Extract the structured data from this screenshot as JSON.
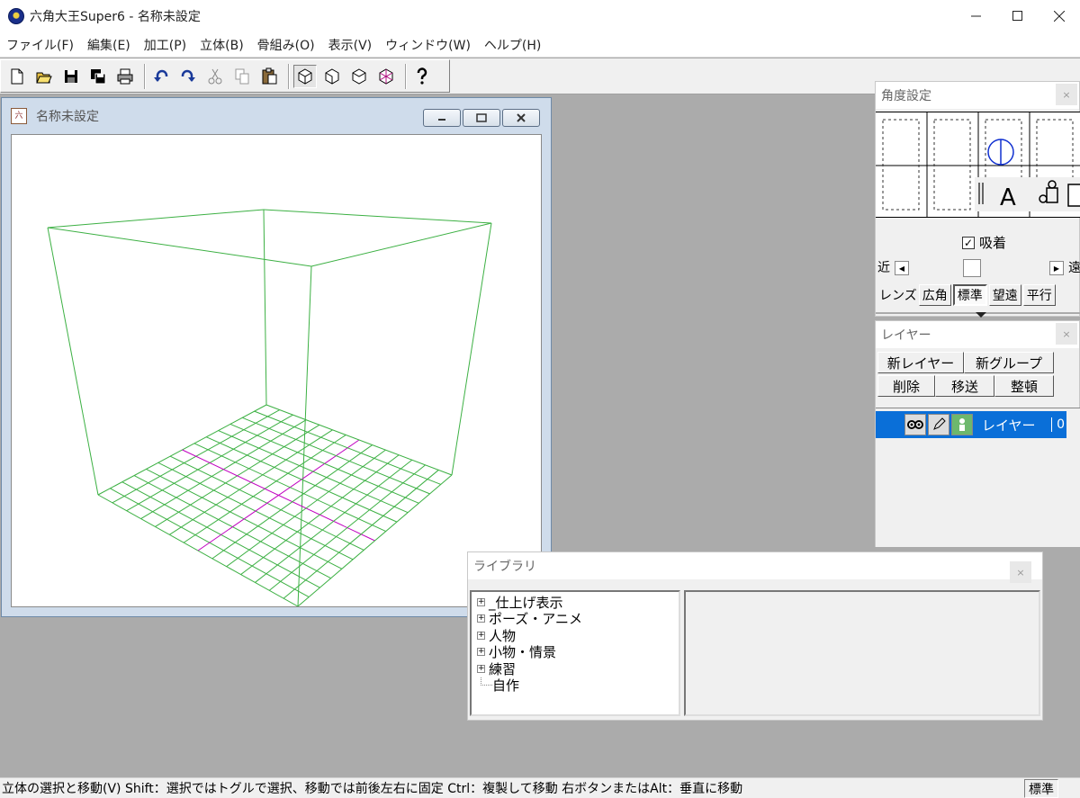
{
  "app": {
    "title": "六角大王Super6 - 名称未設定"
  },
  "window_controls": {
    "minimize": "—",
    "maximize": "☐",
    "close": "✕"
  },
  "menu": [
    {
      "label": "ファイル(F)"
    },
    {
      "label": "編集(E)"
    },
    {
      "label": "加工(P)"
    },
    {
      "label": "立体(B)"
    },
    {
      "label": "骨組み(O)"
    },
    {
      "label": "表示(V)"
    },
    {
      "label": "ウィンドウ(W)"
    },
    {
      "label": "ヘルプ(H)"
    }
  ],
  "toolbar": {
    "buttons": [
      "new-icon",
      "open-icon",
      "save-icon",
      "save-all-icon",
      "print-icon",
      "undo-icon",
      "redo-icon",
      "cut-icon",
      "copy-icon",
      "paste-icon",
      "view-front-icon",
      "view-side-icon",
      "view-top-icon",
      "view-persp-icon",
      "help-icon"
    ]
  },
  "document": {
    "title": "名称未設定"
  },
  "angle_panel": {
    "title": "角度設定",
    "close": "×",
    "snap_label": "吸着",
    "snap_checked": true,
    "check_mark": "✓",
    "near_label": "近",
    "far_label": "遠",
    "lens_label": "レンズ",
    "lens_options": [
      "広角",
      "標準",
      "望遠",
      "平行"
    ],
    "lens_selected": "標準",
    "slider_level": 0.45
  },
  "layer_panel": {
    "title": "レイヤー",
    "close": "×",
    "buttons_row1": [
      "新レイヤー",
      "新グループ"
    ],
    "buttons_row2": [
      "削除",
      "移送",
      "整頓"
    ],
    "layers": [
      {
        "name": "レイヤー",
        "number": "0"
      }
    ]
  },
  "library_panel": {
    "title": "ライブラリ",
    "close": "×",
    "tree": [
      {
        "label": "_仕上げ表示",
        "expandable": true
      },
      {
        "label": "ポーズ・アニメ",
        "expandable": true
      },
      {
        "label": "人物",
        "expandable": true
      },
      {
        "label": "小物・情景",
        "expandable": true
      },
      {
        "label": "練習",
        "expandable": true
      },
      {
        "label": "自作",
        "expandable": false
      }
    ]
  },
  "status": {
    "message": "立体の選択と移動(V)  Shift：選択ではトグルで選択、移動では前後左右に固定  Ctrl：複製して移動  右ボタンまたはAlt：垂直に移動",
    "mode": "標準"
  },
  "colors": {
    "wireframe": "#3cb043",
    "axis": "#c000c0",
    "selection": "#0a6fd8"
  }
}
